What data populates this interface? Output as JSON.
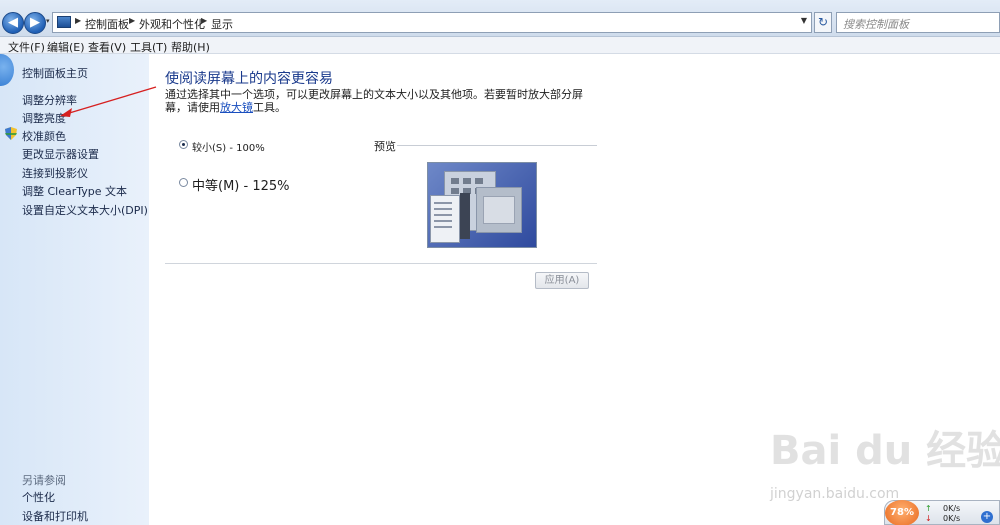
{
  "address_bar": {
    "crumbs": [
      "控制面板",
      "外观和个性化",
      "显示"
    ],
    "search_placeholder": "搜索控制面板"
  },
  "menu": [
    "文件(F)",
    "编辑(E)",
    "查看(V)",
    "工具(T)",
    "帮助(H)"
  ],
  "sidebar": {
    "home": "控制面板主页",
    "links": [
      "调整分辨率",
      "调整亮度",
      "校准颜色",
      "更改显示器设置",
      "连接到投影仪",
      "调整 ClearType 文本",
      "设置自定义文本大小(DPI)"
    ],
    "see_also_title": "另请参阅",
    "see_also": [
      "个性化",
      "设备和打印机"
    ]
  },
  "main": {
    "title": "使阅读屏幕上的内容更容易",
    "description": "通过选择其中一个选项，可以更改屏幕上的文本大小以及其他项。若要暂时放大部分屏幕，请使用",
    "description_link": "放大镜",
    "description_tail": "工具。",
    "options": [
      {
        "label": "较小(S) - 100%",
        "selected": true
      },
      {
        "label": "中等(M) - 125%",
        "selected": false
      }
    ],
    "preview_label": "预览",
    "apply_label": "应用(A)"
  },
  "watermark": {
    "text": "Bai du 经验",
    "url": "jingyan.baidu.com"
  },
  "network_widget": {
    "percent": "78%",
    "up": "0K/s",
    "down": "0K/s"
  }
}
